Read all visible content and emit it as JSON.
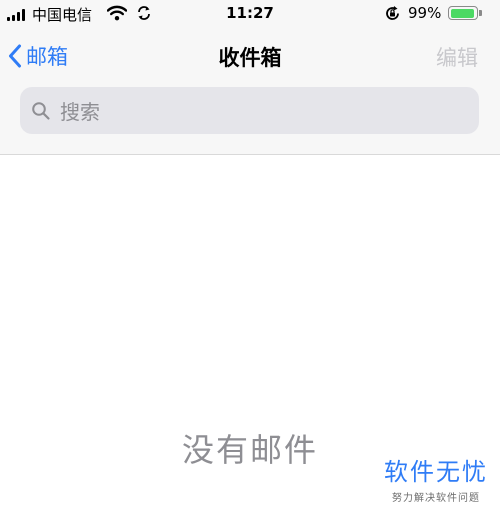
{
  "status_bar": {
    "carrier": "中国电信",
    "time": "11:27",
    "battery_percent": "99%",
    "battery_level": 0.99,
    "battery_color": "#4cd964",
    "icons": [
      "signal-icon",
      "wifi-icon",
      "sync-icon",
      "rotation-lock-icon",
      "battery-icon"
    ]
  },
  "nav": {
    "back_label": "邮箱",
    "title": "收件箱",
    "edit_label": "编辑",
    "accent_color": "#2f7cf6"
  },
  "search": {
    "placeholder": "搜索",
    "value": ""
  },
  "main": {
    "empty_message": "没有邮件"
  },
  "watermark": {
    "brand": "软件无忧",
    "tagline": "努力解决软件问题"
  }
}
